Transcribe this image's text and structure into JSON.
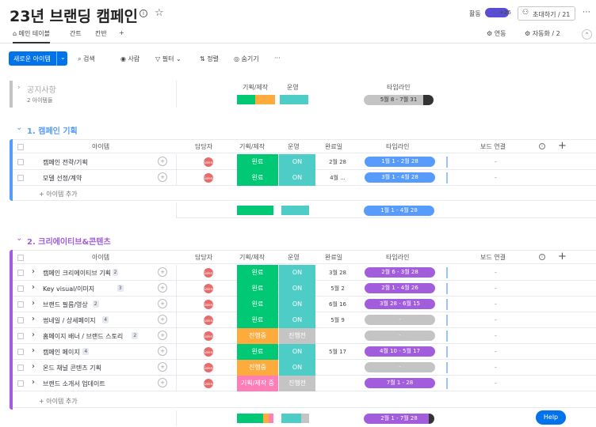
{
  "header": {
    "title": "23년 브랜딩 캠페인",
    "activity_label": "활동",
    "avatar_count": "+26",
    "invite_label": "초대하기 / 21"
  },
  "tabs": [
    {
      "label": "메인 테이블"
    },
    {
      "label": "간트"
    },
    {
      "label": "칸반"
    },
    {
      "label": "+"
    }
  ],
  "tab_right": {
    "integrate": "연동",
    "automate": "자동화 / 2"
  },
  "toolbar": {
    "new_item": "새로운 아이템",
    "search": "검색",
    "person": "사람",
    "filter": "필터",
    "sort": "정렬",
    "hide": "숨기기",
    "more": "···"
  },
  "notice_group": {
    "name": "공지사항",
    "count": "2 아이템들",
    "col_plan": "기획/제작",
    "col_ops": "운영",
    "col_timeline": "타임라인",
    "timeline": "5월 8 - 7월 31"
  },
  "columns": {
    "item": "아이템",
    "owner": "담당자",
    "plan": "기획/제작",
    "ops": "운영",
    "done": "완료일",
    "timeline": "타임라인",
    "board": "보드 연결",
    "add": "+"
  },
  "group1": {
    "name": "1. 캠페인 기획",
    "color": "#579bfc",
    "rows": [
      {
        "name": "캠페인 전략/기획",
        "plan": "완료",
        "ops": "ON",
        "done": "2월 28",
        "timeline": "1월 1 - 2월 28",
        "board": "-"
      },
      {
        "name": "모델 선정/계약",
        "plan": "완료",
        "ops": "ON",
        "done": "4월 ...",
        "timeline": "3월 1 - 4월 28",
        "board": "-"
      }
    ],
    "add_item": "+ 아이템 추가",
    "summary_timeline": "1월 1 - 4월 28"
  },
  "group2": {
    "name": "2. 크리에이티브&콘텐츠",
    "color": "#a25ddc",
    "rows": [
      {
        "name": "캠페인 크리에이티브 기획",
        "badge": "2",
        "plan": "완료",
        "ops": "ON",
        "done": "3월 28",
        "timeline": "2월 6 - 3월 28",
        "board": "-"
      },
      {
        "name": "Key visual/이미지",
        "badge": "3",
        "plan": "완료",
        "ops": "ON",
        "done": "5월 2",
        "timeline": "2월 1 - 4월 26",
        "board": "-"
      },
      {
        "name": "브랜드 필름/영상",
        "badge": "2",
        "plan": "완료",
        "ops": "ON",
        "done": "6월 16",
        "timeline": "3월 28 - 6월 15",
        "board": "-"
      },
      {
        "name": "썸네일 / 상세페이지",
        "badge": "4",
        "plan": "완료",
        "ops": "ON",
        "done": "5월 9",
        "timeline": "-",
        "board": "-"
      },
      {
        "name": "홈페이지 배너 / 브랜드 스토리",
        "badge": "2",
        "plan": "진행중",
        "ops": "진행전",
        "done": "",
        "timeline": "-",
        "board": "-"
      },
      {
        "name": "캠페인 페이지",
        "badge": "4",
        "plan": "완료",
        "ops": "ON",
        "done": "5월 17",
        "timeline": "4월 10 - 5월 17",
        "board": "-"
      },
      {
        "name": "온드 채널 콘텐츠 기획",
        "badge": "",
        "plan": "진행중",
        "ops": "ON",
        "done": "",
        "timeline": "-",
        "board": "-"
      },
      {
        "name": "브랜드 소개서 업데이트",
        "badge": "",
        "plan": "기획/제작 중",
        "ops": "진행전",
        "done": "",
        "timeline": "7월 1 - 28",
        "board": "-"
      }
    ],
    "add_item": "+ 아이템 추가",
    "summary_timeline": "2월 1 - 7월 28"
  },
  "avatars": {
    "label_a": "Salena",
    "label_b": "BM1",
    "label_c": "+2",
    "label_d": "피나니",
    "label_e": "심니"
  },
  "help": "Help",
  "colors": {
    "green": "#00c875",
    "orange": "#fdab3d",
    "teal": "#4eccc6",
    "grey": "#c4c4c4",
    "pink": "#ff7eb9",
    "blue": "#579bfc",
    "purple": "#a25ddc",
    "dark": "#333"
  }
}
